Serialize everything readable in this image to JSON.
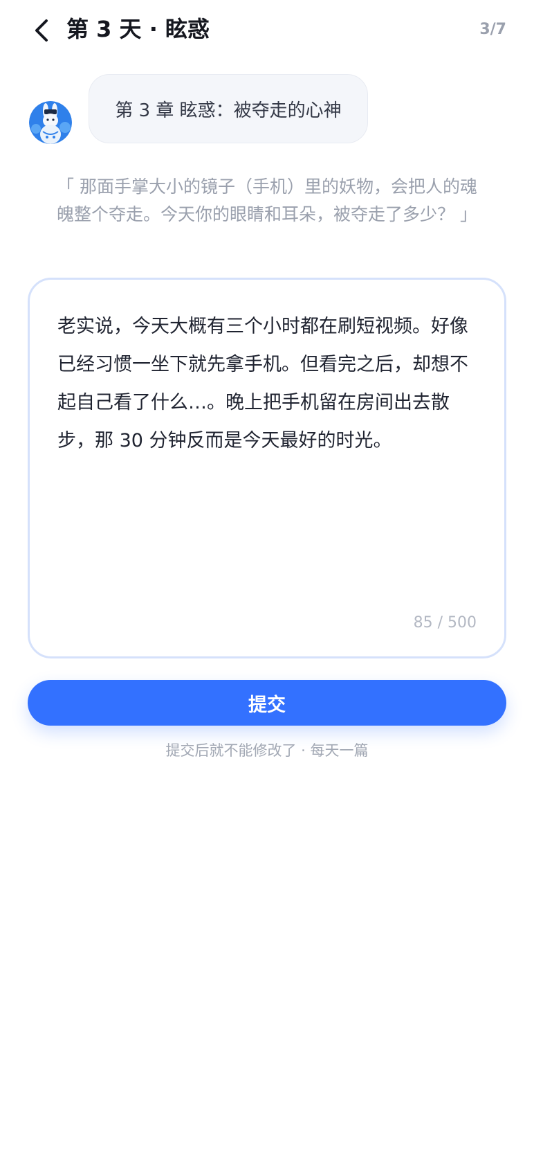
{
  "header": {
    "title": "第 3 天 · 眩惑",
    "progress": "3/7",
    "back_icon": "chevron-left-icon"
  },
  "chapter": {
    "bubble_text": "第 3 章 眩惑：被夺走的心神",
    "avatar_icon": "rabbit-avatar"
  },
  "prompt": {
    "quote": "「 那面手掌大小的镜子（手机）里的妖物，会把人的魂魄整个夺走。今天你的眼睛和耳朵，被夺走了多少？ 」"
  },
  "editor": {
    "text": "老实说，今天大概有三个小时都在刷短视频。好像已经习惯一坐下就先拿手机。但看完之后，却想不起自己看了什么…。晚上把手机留在房间出去散步，那 30 分钟反而是今天最好的时光。",
    "counter": "85 / 500"
  },
  "submit": {
    "label": "提交",
    "hint": "提交后就不能修改了 · 每天一篇"
  },
  "colors": {
    "accent": "#3371ff",
    "muted": "#9aa0ad",
    "bubble_bg": "#f4f6fa",
    "editor_border": "#d5e1fb"
  }
}
